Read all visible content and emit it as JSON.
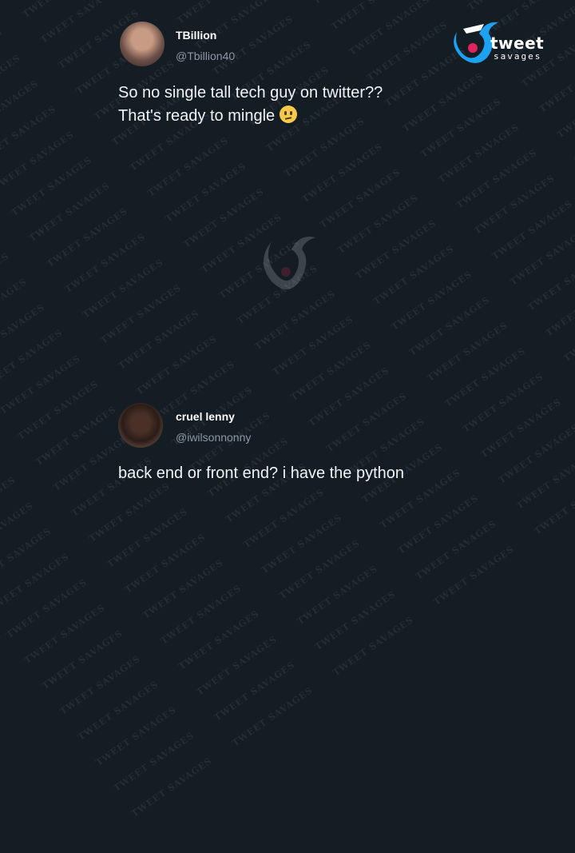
{
  "tweet1": {
    "name": "TBillion",
    "handle": "@Tbillion40",
    "text_line1": "So no single tall tech guy on twitter??",
    "text_line2": "That's ready to mingle"
  },
  "tweet2": {
    "name": "cruel lenny",
    "handle": "@iwilsonnonny",
    "text": "back end or front end? i have the python"
  },
  "logo": {
    "name": "tweet",
    "sub": "savages"
  },
  "watermark": "TWEET SAVAGES",
  "colors": {
    "background": "#141c24",
    "brand_blue": "#1da1f2",
    "brand_red": "#e0245e"
  }
}
